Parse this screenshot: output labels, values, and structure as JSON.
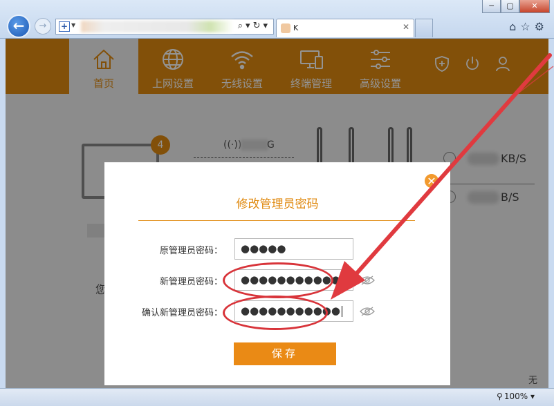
{
  "browser": {
    "tab_title": "K",
    "window_buttons": [
      "─",
      "▢",
      "✕"
    ],
    "zoom": "100%"
  },
  "nav": {
    "items": [
      {
        "label": "首页",
        "icon": "home-icon"
      },
      {
        "label": "上网设置",
        "icon": "globe-icon"
      },
      {
        "label": "无线设置",
        "icon": "wifi-icon"
      },
      {
        "label": "终端管理",
        "icon": "devices-icon"
      },
      {
        "label": "高级设置",
        "icon": "sliders-icon"
      }
    ],
    "active_index": 0,
    "tools": [
      "shield-icon",
      "power-icon",
      "user-icon"
    ]
  },
  "background": {
    "device_count": "4",
    "wifi_band_suffix": "G",
    "upload_unit": "KB/S",
    "download_unit": "B/S",
    "hint_char": "您",
    "bottom_right_char": "无"
  },
  "modal": {
    "title": "修改管理员密码",
    "fields": [
      {
        "label": "原管理员密码：",
        "value": "●●●●●",
        "has_eye": false
      },
      {
        "label": "新管理员密码：",
        "value": "●●●●●●●●●●●",
        "has_eye": true
      },
      {
        "label": "确认新管理员密码：",
        "value": "●●●●●●●●●●●",
        "has_eye": true
      }
    ],
    "save_label": "保存"
  },
  "colors": {
    "brand": "#e08a10",
    "annotation": "#d8343a"
  }
}
